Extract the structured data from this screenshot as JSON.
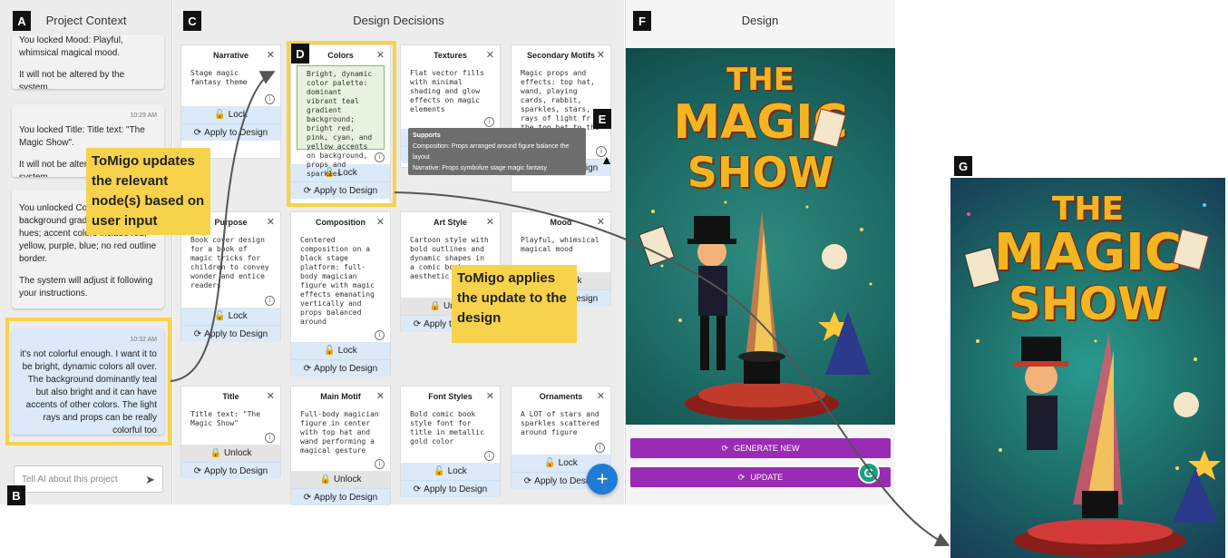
{
  "badges": {
    "a": "A",
    "b": "B",
    "c": "C",
    "d": "D",
    "e": "E",
    "f": "F",
    "g": "G"
  },
  "panels": {
    "context": "Project Context",
    "decisions": "Design Decisions",
    "design": "Design"
  },
  "chat": {
    "msg1_line1": "You locked Mood: Playful, whimsical magical mood.",
    "msg1_line2": "It will not be altered by the system.",
    "msg2_time": "10:29 AM",
    "msg2_line1": "You locked Title: Title text: \"The Magic Show\".",
    "msg2_line2": "It will not be altered by the system.",
    "msg3_line1": "You unlocked Colors: Rich background gradient with jewel hues; accent colors include red, yellow, purple, blue; no red outline border.",
    "msg3_line2": "The system will adjust it following your instructions.",
    "user_time": "10:32 AM",
    "user_text": "it's not colorful enough. I want it to be bright, dynamic colors all over. The background dominantly teal but also bright and it can have accents of other colors. The light rays and props can be really colorful too",
    "input_placeholder": "Tell AI about this project"
  },
  "callouts": {
    "updates": "ToMigo updates the relevant node(s) based on user input",
    "applies": "ToMigo applies the update to the design"
  },
  "actions": {
    "lock": "Lock",
    "unlock": "Unlock",
    "apply": "Apply to Design"
  },
  "cards": {
    "narrative": {
      "title": "Narrative",
      "body": "Stage magic fantasy theme"
    },
    "colors": {
      "title": "Colors",
      "body": "Bright, dynamic color palette: dominant vibrant teal gradient background; bright red, pink, cyan, and yellow accents on background, props and sparkles"
    },
    "textures": {
      "title": "Textures",
      "body": "Flat vector fills with minimal shading and glow effects on magic elements"
    },
    "secondary": {
      "title": "Secondary Motifs",
      "body": "Magic props and effects: top hat, wand, playing cards, rabbit, sparkles, stars, rays of light fr the top hat to the mag"
    },
    "purpose": {
      "title": "Purpose",
      "body": "Book cover design for a book of magic tricks for children to convey wonder and entice readers"
    },
    "composition": {
      "title": "Composition",
      "body": "Centered composition on a black stage platform: full-body magician figure with magic effects emanating vertically and props balanced around"
    },
    "artstyle": {
      "title": "Art Style",
      "body": "Cartoon style with bold outlines and dynamic shapes in a comic book aesthetic"
    },
    "mood": {
      "title": "Mood",
      "body": "Playful, whimsical magical mood"
    },
    "title": {
      "title": "Title",
      "body": "Title text: \"The Magic Show\""
    },
    "mainmotif": {
      "title": "Main Motif",
      "body": "Full-body magician figure in center with top hat and wand performing a magical gesture"
    },
    "fontstyles": {
      "title": "Font Styles",
      "body": "Bold comic book style font for title in metallic gold color"
    },
    "ornaments": {
      "title": "Ornaments",
      "body": "A LOT of stars and sparkles scattered around figure"
    }
  },
  "tooltip": {
    "heading": "Supports",
    "line1": "Composition: Props arranged around figure balance the layout",
    "line2": "Narrative: Props symbolize stage magic fantasy"
  },
  "design": {
    "poster_title_1": "THE",
    "poster_title_2": "MAGIC",
    "poster_title_3": "SHOW",
    "generate_label": "GENERATE NEW",
    "update_label": "UPDATE",
    "g_badge": "G"
  },
  "colors": {
    "accent_yellow": "#f7d24b",
    "purple": "#9a2bb4",
    "fab_blue": "#1e7bd6",
    "lock_blue": "#dbe9f8"
  }
}
